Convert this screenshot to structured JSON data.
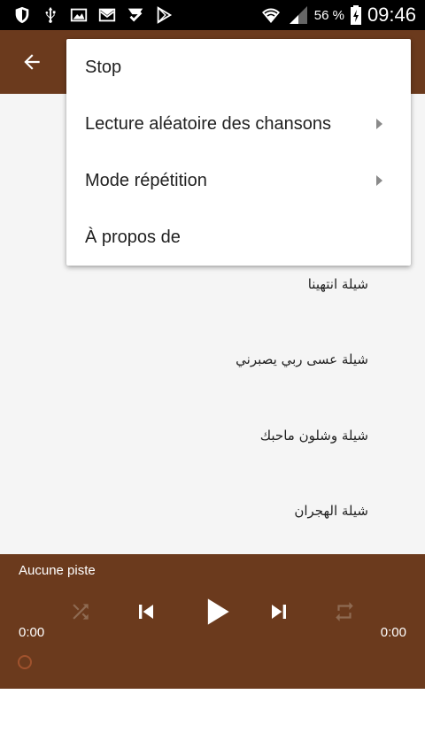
{
  "status_bar": {
    "battery_percent": "56 %",
    "time": "09:46",
    "left_icons": [
      "shield-icon",
      "usb-icon",
      "image-icon",
      "mail-icon",
      "download-check-icon",
      "play-store-icon"
    ],
    "right_icons": [
      "wifi-icon",
      "signal-icon",
      "battery-icon"
    ]
  },
  "toolbar": {
    "back_icon": "arrow-back-icon",
    "color": "#6b3a1d"
  },
  "menu": {
    "items": [
      {
        "label": "Stop",
        "has_submenu": false
      },
      {
        "label": "Lecture aléatoire des chansons",
        "has_submenu": true
      },
      {
        "label": "Mode répétition",
        "has_submenu": true
      },
      {
        "label": "À propos de",
        "has_submenu": false
      }
    ]
  },
  "songs": [
    "شيلة انتهينا",
    "شيلة عسى ربي يصبرني",
    "شيلة وشلون ماحبك",
    "شيلة الهجران"
  ],
  "player": {
    "track_title": "Aucune piste",
    "time_elapsed": "0:00",
    "time_total": "0:00",
    "controls": [
      "shuffle-icon",
      "previous-icon",
      "play-icon",
      "next-icon",
      "repeat-icon"
    ],
    "accent": "#a0522d"
  }
}
